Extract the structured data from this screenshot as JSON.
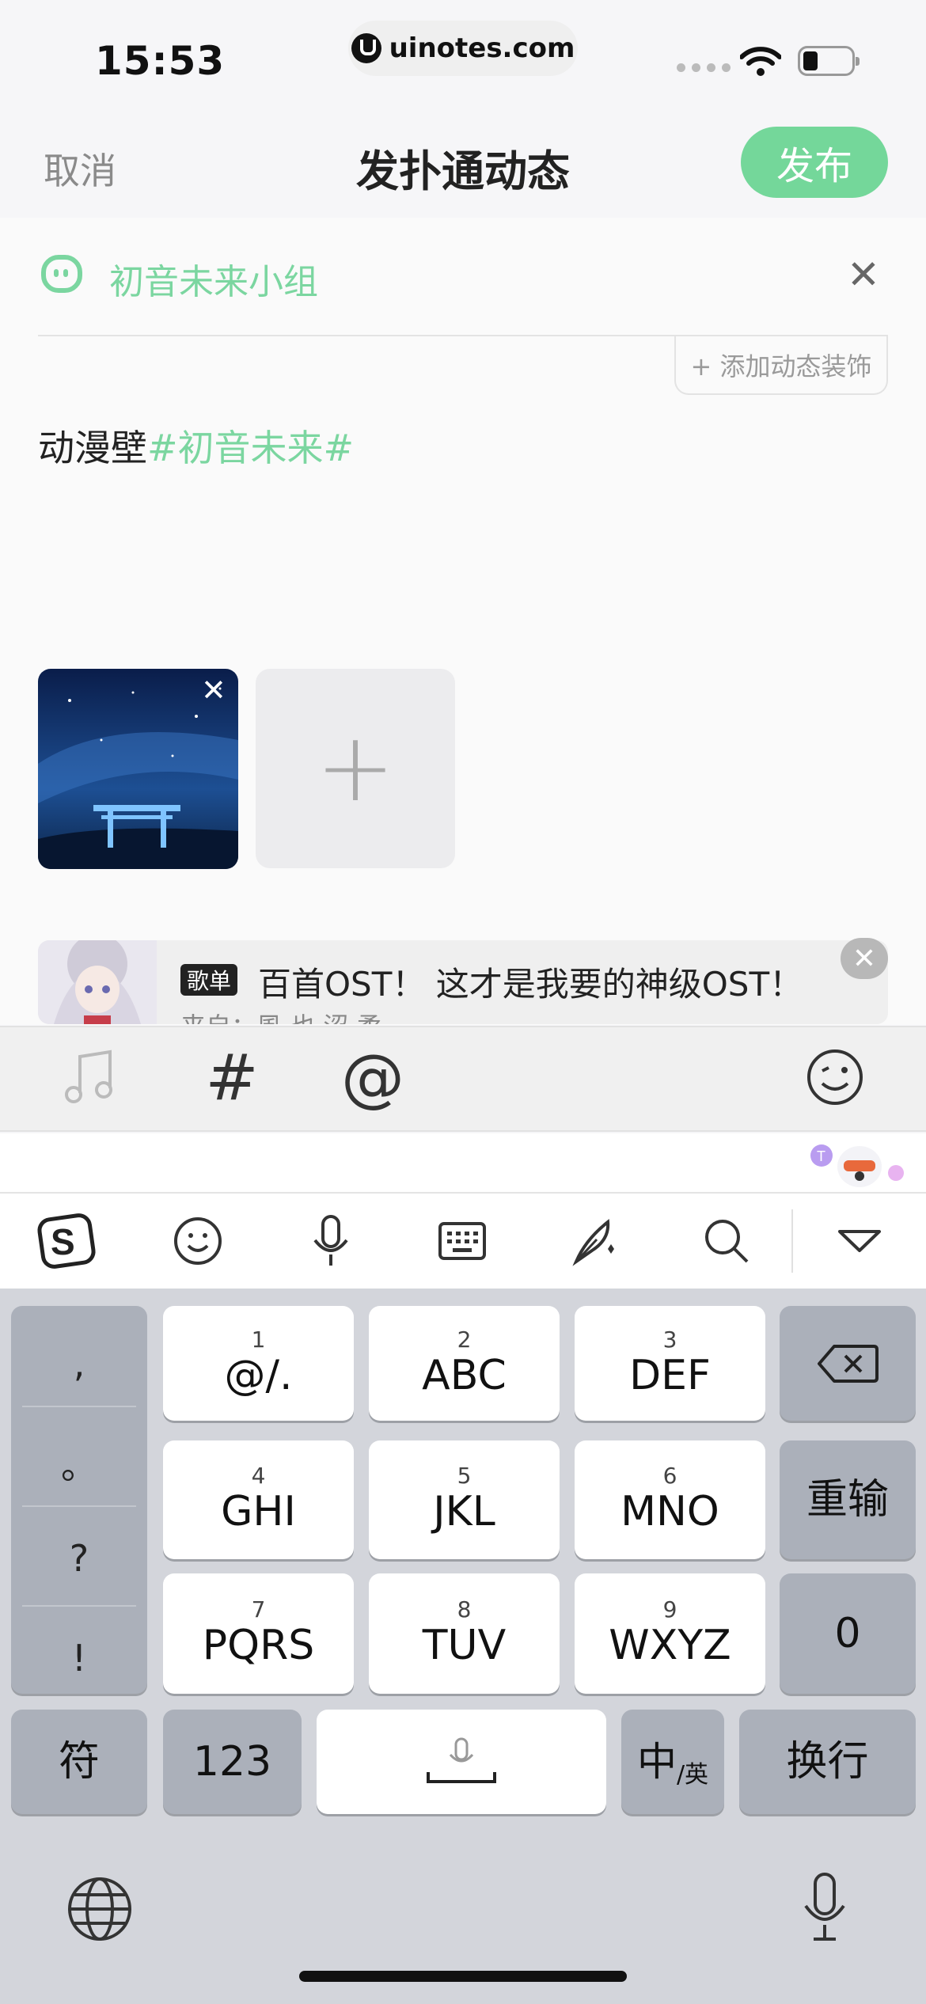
{
  "status": {
    "time": "15:53",
    "url": "uinotes.com"
  },
  "header": {
    "cancel": "取消",
    "title": "发扑通动态",
    "publish": "发布"
  },
  "group": {
    "name": "初音未来小组"
  },
  "decor": {
    "label": "+ 添加动态装饰"
  },
  "post": {
    "text": "动漫壁",
    "tag": "#初音未来#"
  },
  "music": {
    "badge": "歌单",
    "title": "百首OST！ 这才是我要的神级OST！",
    "subtitle": "来自：風 也 涩 柔"
  },
  "icons": {
    "music": "music-note-icon",
    "hash": "hash-icon",
    "at": "at-icon",
    "emoji": "emoji-icon",
    "sogou": "sogou-logo-icon",
    "kb_emoji": "smiley-icon",
    "voice": "microphone-icon",
    "keyboard": "keyboard-icon",
    "handwrite": "quill-icon",
    "search": "search-icon",
    "collapse": "chevron-down-icon",
    "globe": "globe-icon",
    "dictate": "microphone-icon",
    "delete": "backspace-icon"
  },
  "toolbar": {
    "hash": "#",
    "at": "@"
  },
  "keyboard": {
    "punct": [
      ",",
      "。",
      "?",
      "!"
    ],
    "keys": [
      {
        "num": "1",
        "label": "@/."
      },
      {
        "num": "2",
        "label": "ABC"
      },
      {
        "num": "3",
        "label": "DEF"
      },
      {
        "num": "4",
        "label": "GHI"
      },
      {
        "num": "5",
        "label": "JKL"
      },
      {
        "num": "6",
        "label": "MNO"
      },
      {
        "num": "7",
        "label": "PQRS"
      },
      {
        "num": "8",
        "label": "TUV"
      },
      {
        "num": "9",
        "label": "WXYZ"
      }
    ],
    "reenter": "重输",
    "zero": "0",
    "symbols": "符",
    "numbers": "123",
    "lang_main": "中",
    "lang_sub": "/英",
    "newline": "换行"
  },
  "colors": {
    "accent": "#74d79a",
    "tag": "#7bd6a0",
    "keyboard_bg": "#d3d5db"
  }
}
